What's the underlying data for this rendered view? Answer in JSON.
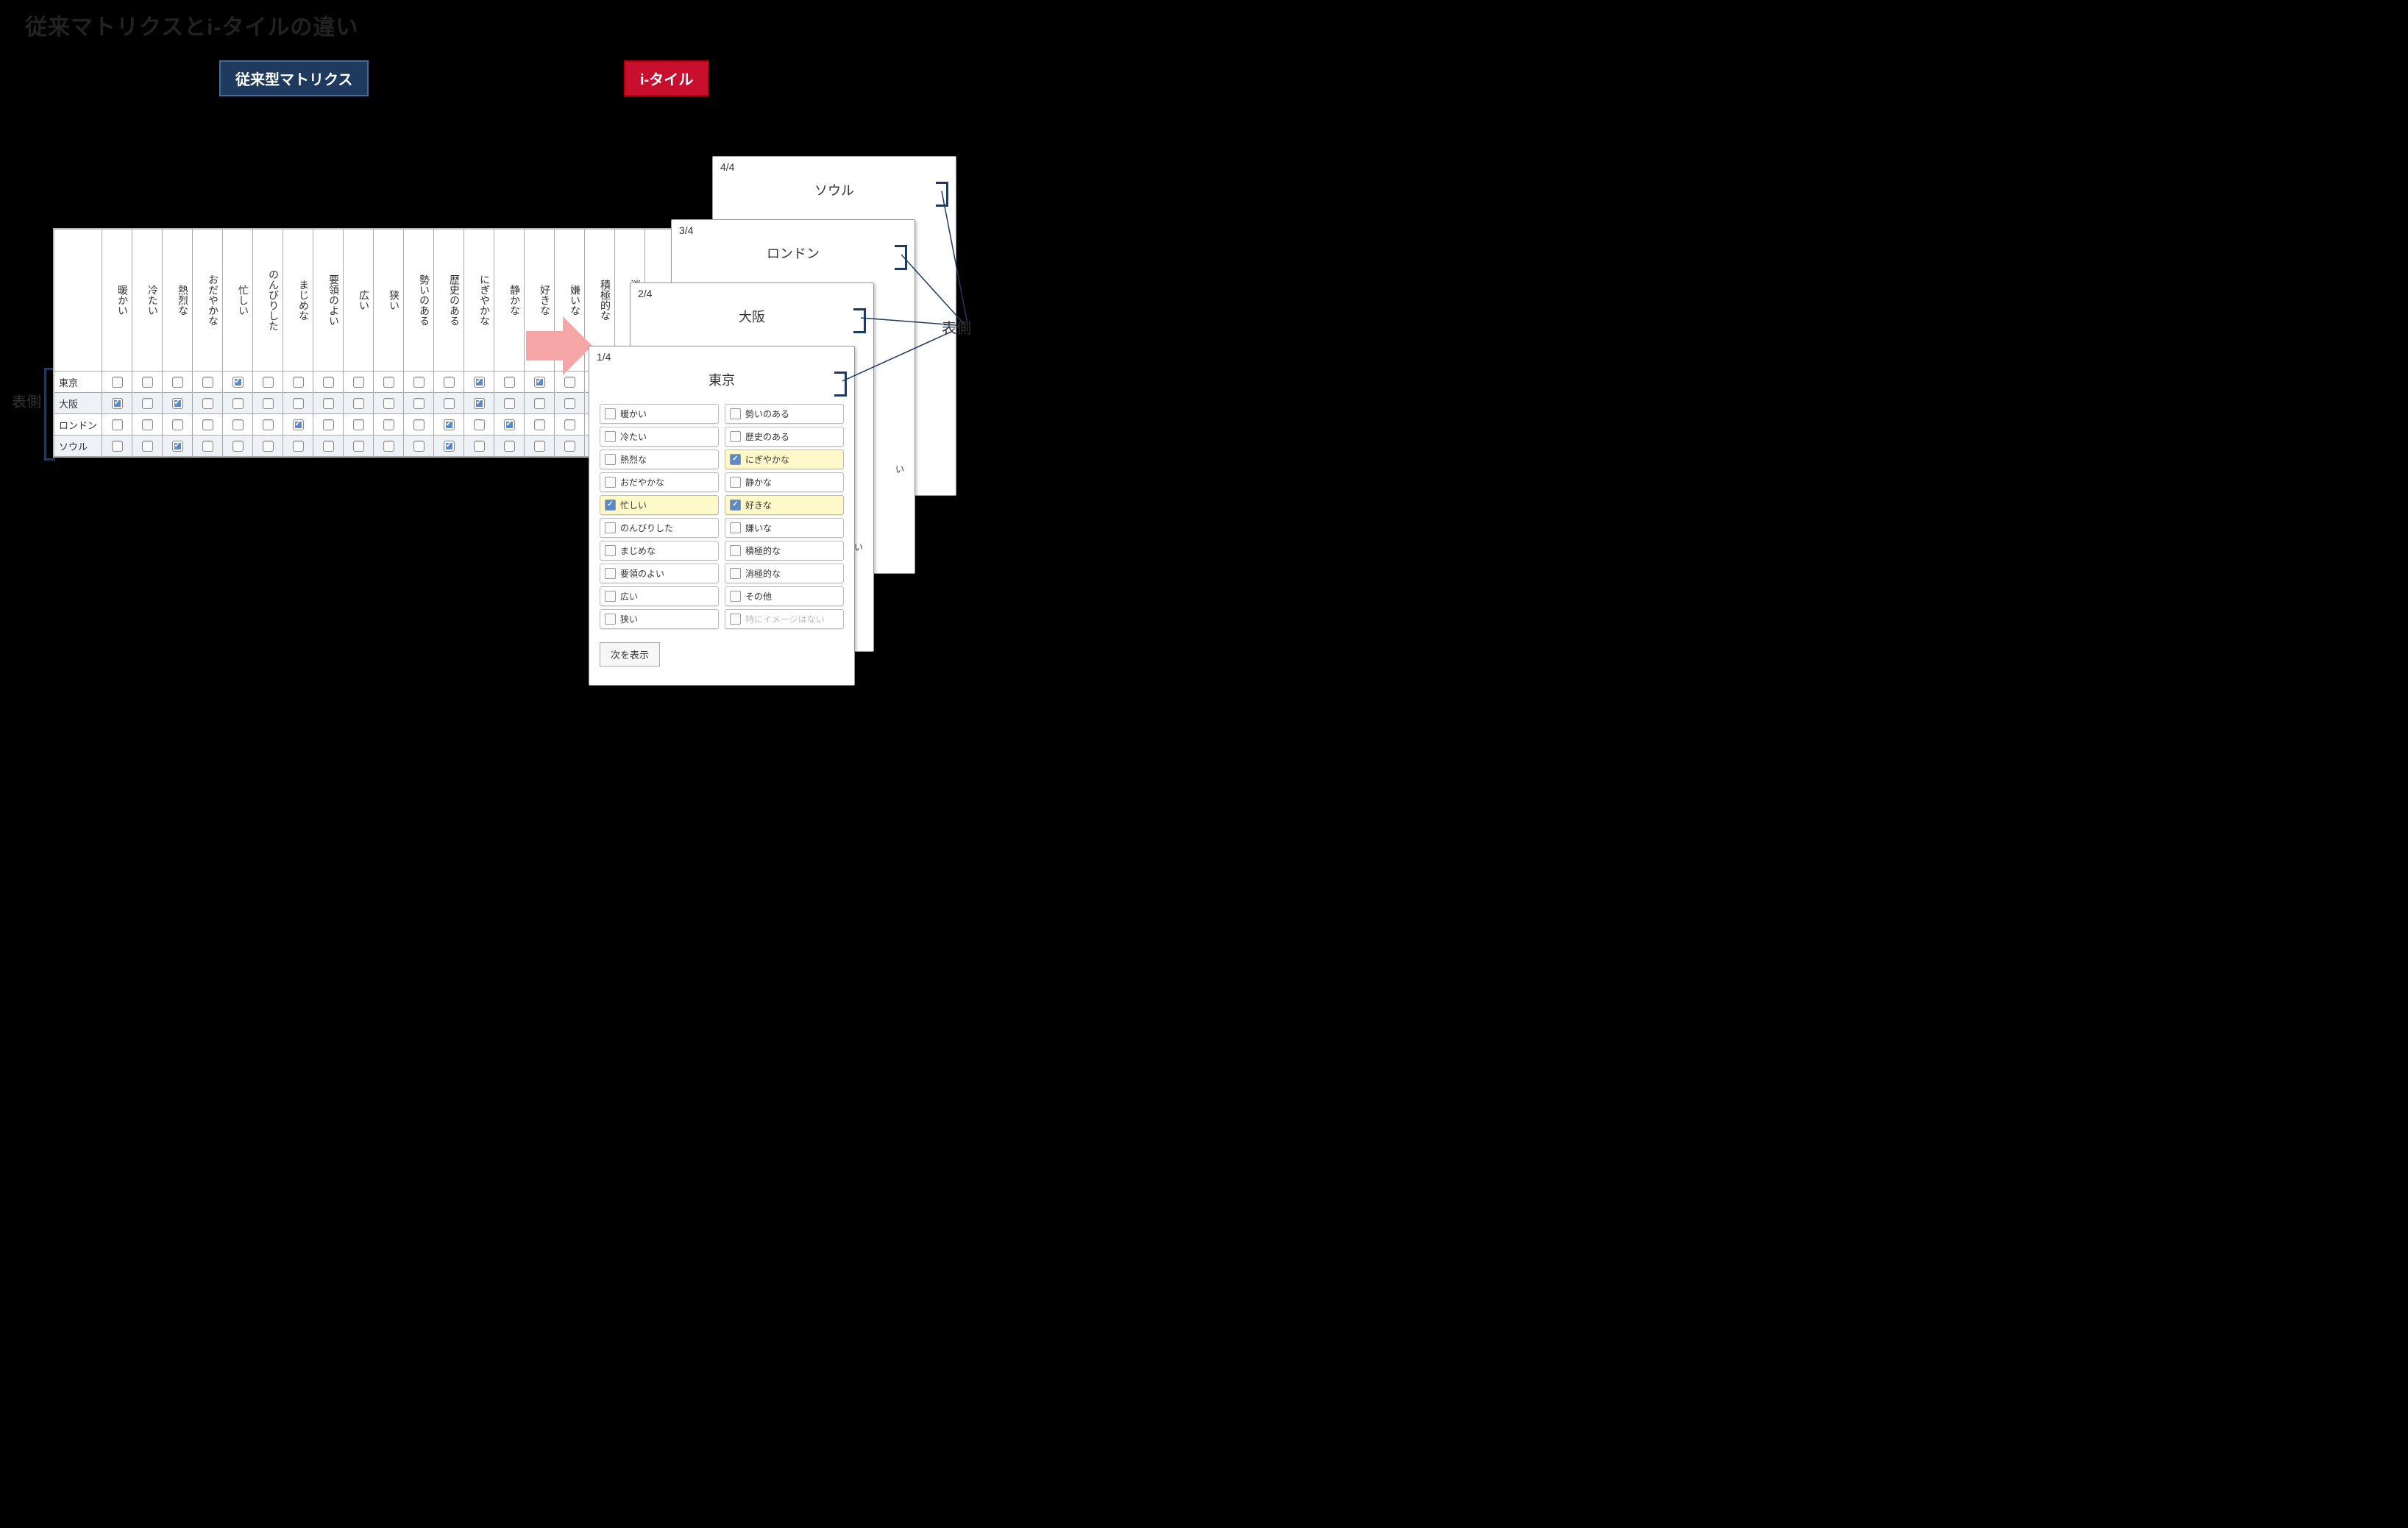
{
  "title": "従来マトリクスとi-タイルの違い",
  "badges": {
    "classic": "従来型マトリクス",
    "itile": "i-タイル"
  },
  "side_label": "表側",
  "columns": [
    "暖かい",
    "冷たい",
    "熱烈な",
    "おだやかな",
    "忙しい",
    "のんびりした",
    "まじめな",
    "要領のよい",
    "広い",
    "狭い",
    "勢いのある",
    "歴史のある",
    "にぎやかな",
    "静かな",
    "好きな",
    "嫌いな",
    "積極的な",
    "消極的な",
    "その他",
    "特にイメージはない"
  ],
  "rows": [
    {
      "name": "東京",
      "checks": [
        0,
        0,
        0,
        0,
        1,
        0,
        0,
        0,
        0,
        0,
        0,
        0,
        1,
        0,
        1,
        0,
        0,
        0,
        0,
        0
      ]
    },
    {
      "name": "大阪",
      "checks": [
        1,
        0,
        1,
        0,
        0,
        0,
        0,
        0,
        0,
        0,
        0,
        0,
        1,
        0,
        0,
        0,
        1,
        0,
        0,
        0
      ]
    },
    {
      "name": "ロンドン",
      "checks": [
        0,
        0,
        0,
        0,
        0,
        0,
        1,
        0,
        0,
        0,
        0,
        1,
        0,
        1,
        0,
        0,
        0,
        0,
        0,
        0
      ]
    },
    {
      "name": "ソウル",
      "checks": [
        0,
        0,
        1,
        0,
        0,
        0,
        0,
        0,
        0,
        0,
        0,
        1,
        0,
        0,
        0,
        0,
        1,
        0,
        0,
        0
      ]
    }
  ],
  "cards": [
    {
      "num": "4/4",
      "title": "ソウル"
    },
    {
      "num": "3/4",
      "title": "ロンドン"
    },
    {
      "num": "2/4",
      "title": "大阪"
    },
    {
      "num": "1/4",
      "title": "東京"
    }
  ],
  "tile_options_left": [
    "暖かい",
    "冷たい",
    "熱烈な",
    "おだやかな",
    "忙しい",
    "のんびりした",
    "まじめな",
    "要領のよい",
    "広い",
    "狭い"
  ],
  "tile_options_right": [
    "勢いのある",
    "歴史のある",
    "にぎやかな",
    "静かな",
    "好きな",
    "嫌いな",
    "積極的な",
    "消極的な",
    "その他",
    "特にイメージはない"
  ],
  "tile_selected": [
    "忙しい",
    "にぎやかな",
    "好きな"
  ],
  "tile_muted": [
    "特にイメージはない"
  ],
  "peek_behind": [
    "い",
    "はない"
  ],
  "next_button": "次を表示"
}
